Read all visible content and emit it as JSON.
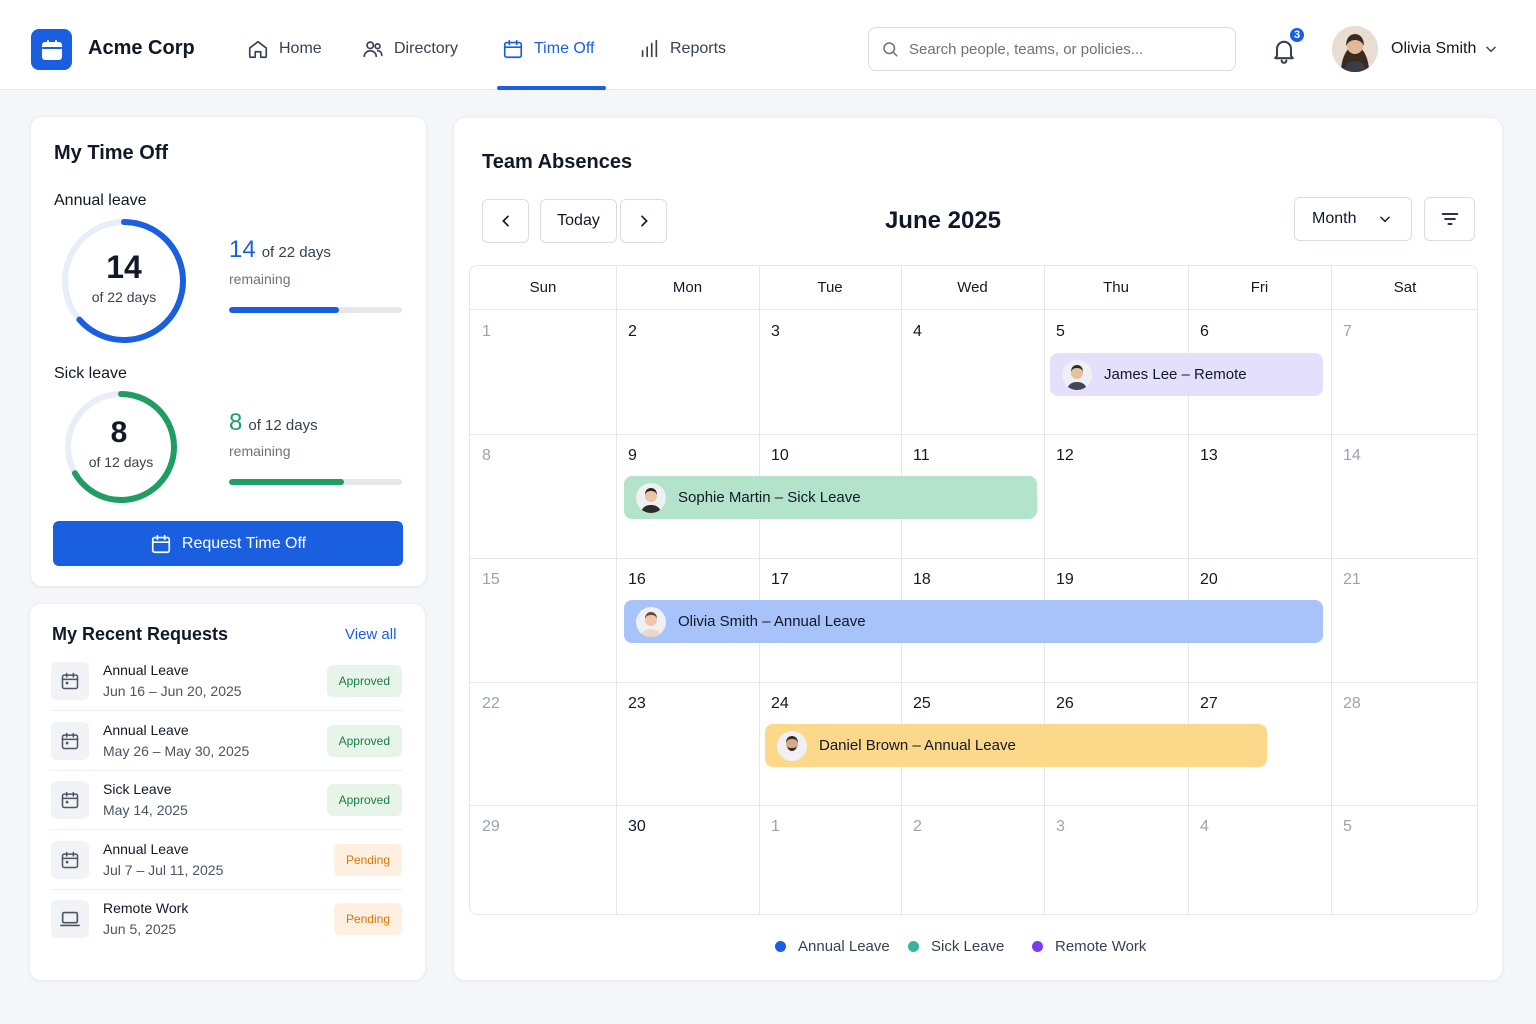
{
  "app": {
    "brand": "Acme Corp"
  },
  "nav": {
    "home": "Home",
    "directory": "Directory",
    "time_off": "Time Off",
    "reports": "Reports"
  },
  "search": {
    "placeholder": "Search people, teams, or policies..."
  },
  "notifications": {
    "count": "3"
  },
  "user": {
    "name": "Olivia Smith"
  },
  "my_time_off": {
    "title": "My Time Off",
    "annual": {
      "label": "Annual leave",
      "remaining": "14",
      "total_text": "of 22 days",
      "remaining_word": "remaining",
      "fraction": 0.636,
      "color": "#1a5fe0"
    },
    "sick": {
      "label": "Sick leave",
      "remaining": "8",
      "total_text": "of 12 days",
      "remaining_word": "remaining",
      "fraction": 0.667,
      "color": "#1f9d62"
    },
    "request_button": "Request Time Off"
  },
  "recent_requests": {
    "title": "My Recent Requests",
    "view_all": "View all",
    "items": [
      {
        "type": "Annual Leave",
        "dates": "Jun 16 – Jun 20, 2025",
        "status": "Approved",
        "icon": "calendar-icon"
      },
      {
        "type": "Annual Leave",
        "dates": "May 26 – May 30, 2025",
        "status": "Approved",
        "icon": "calendar-icon"
      },
      {
        "type": "Sick Leave",
        "dates": "May 14, 2025",
        "status": "Approved",
        "icon": "calendar-icon"
      },
      {
        "type": "Annual Leave",
        "dates": "Jul 7 – Jul 11, 2025",
        "status": "Pending",
        "icon": "calendar-icon"
      },
      {
        "type": "Remote Work",
        "dates": "Jun 5, 2025",
        "status": "Pending",
        "icon": "laptop-icon"
      }
    ]
  },
  "calendar": {
    "title": "Team Absences",
    "month_label": "June 2025",
    "today_label": "Today",
    "view_select": "Month",
    "days_of_week": [
      "Sun",
      "Mon",
      "Tue",
      "Wed",
      "Thu",
      "Fri",
      "Sat"
    ],
    "weeks": [
      [
        "1",
        "2",
        "3",
        "4",
        "5",
        "6",
        "7"
      ],
      [
        "8",
        "9",
        "10",
        "11",
        "12",
        "13",
        "14"
      ],
      [
        "15",
        "16",
        "17",
        "18",
        "19",
        "20",
        "21"
      ],
      [
        "22",
        "23",
        "24",
        "25",
        "26",
        "27",
        "28"
      ],
      [
        "29",
        "30",
        "1",
        "2",
        "3",
        "4",
        "5"
      ]
    ],
    "events": [
      {
        "label": "James Lee – Remote",
        "color": "#e4e0fb"
      },
      {
        "label": "Sophie Martin – Sick Leave",
        "color": "#b4e3cb"
      },
      {
        "label": "Olivia Smith – Annual Leave",
        "color": "#a7c3fa"
      },
      {
        "label": "Daniel Brown – Annual Leave",
        "color": "#fcd98a"
      }
    ],
    "legend": [
      {
        "label": "Annual Leave",
        "color": "#1a5fe0"
      },
      {
        "label": "Sick Leave",
        "color": "#3bb39a"
      },
      {
        "label": "Remote Work",
        "color": "#7c3aed"
      }
    ]
  }
}
